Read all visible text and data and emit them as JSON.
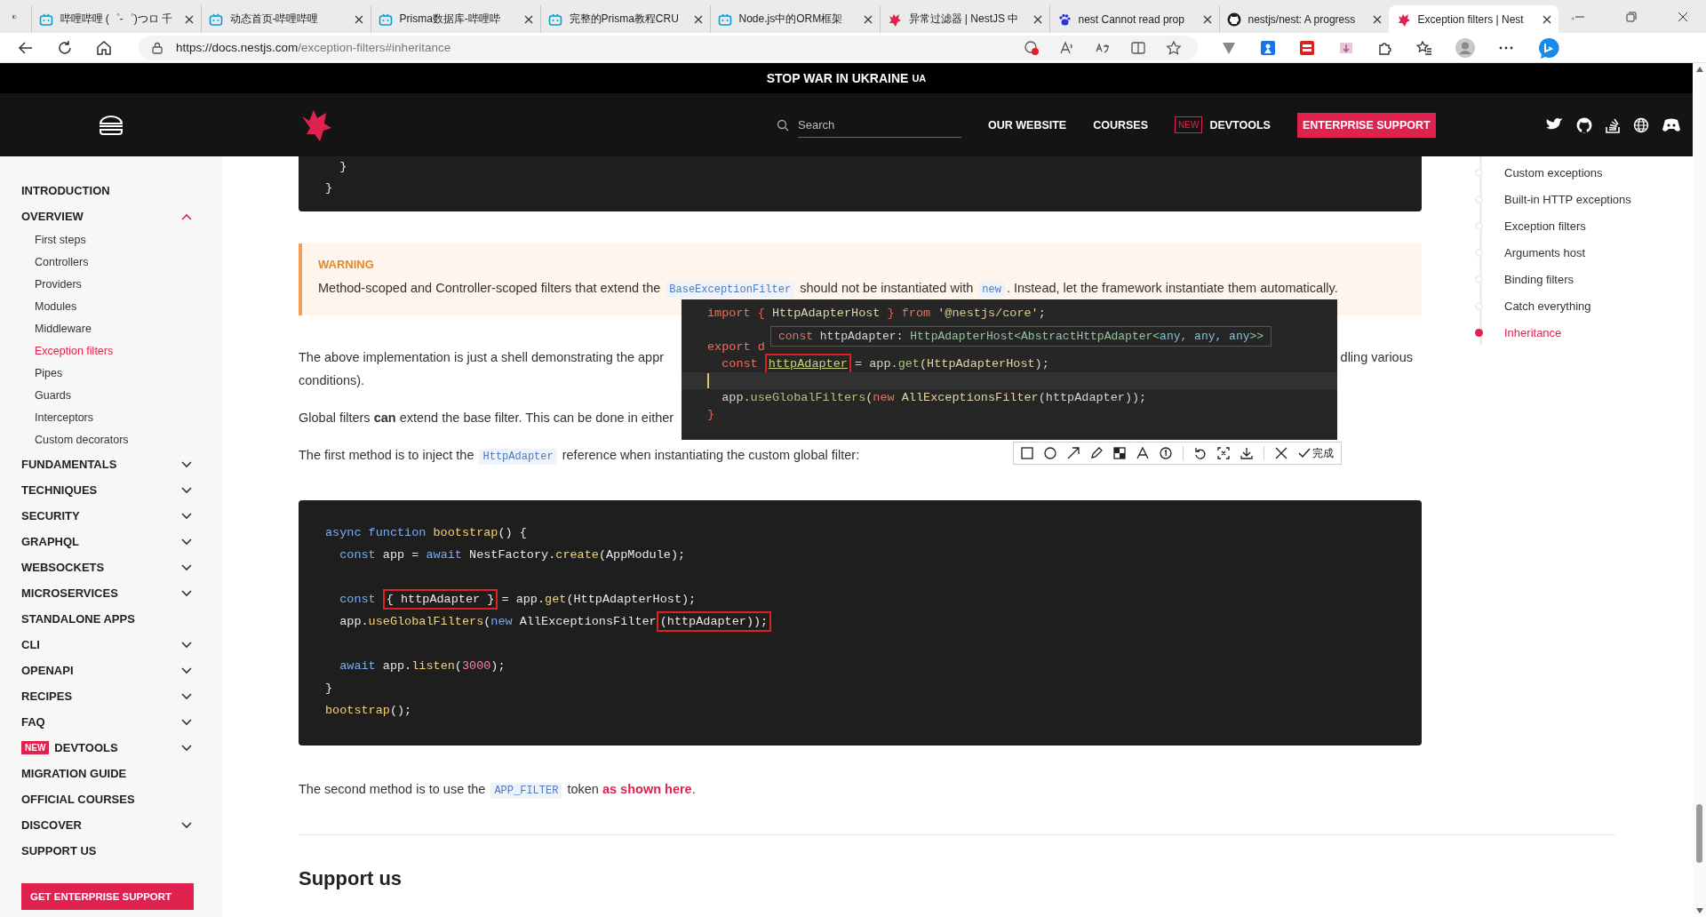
{
  "browser": {
    "tabs": [
      {
        "title": "哔哩哔哩 (゜-゜)つロ 千",
        "kind": "tv",
        "selected": false
      },
      {
        "title": "动态首页-哔哩哔哩",
        "kind": "tv",
        "selected": false
      },
      {
        "title": "Prisma数据库-哔哩哔",
        "kind": "tv",
        "selected": false
      },
      {
        "title": "完整的Prisma教程CRU",
        "kind": "tv",
        "selected": false
      },
      {
        "title": "Node.js中的ORM框架",
        "kind": "tv",
        "selected": false
      },
      {
        "title": "异常过滤器 | NestJS 中",
        "kind": "cat",
        "selected": false
      },
      {
        "title": "nest Cannot read prop",
        "kind": "paw",
        "selected": false
      },
      {
        "title": "nestjs/nest: A progress",
        "kind": "mark",
        "selected": false
      },
      {
        "title": "Exception filters | Nest",
        "kind": "cat",
        "selected": true
      }
    ],
    "url_host": "https://docs.nestjs.com",
    "url_path": "/exception-filters#inheritance"
  },
  "banner": {
    "text": "STOP WAR IN UKRAINE",
    "tag": "UA"
  },
  "nav": {
    "search": {
      "placeholder": "Search"
    },
    "links": [
      "OUR WEBSITE",
      "COURSES"
    ],
    "devtools": {
      "badge": "NEW",
      "label": "DEVTOOLS"
    },
    "cta": "ENTERPRISE SUPPORT"
  },
  "sidebar": {
    "items": [
      {
        "label": "INTRODUCTION",
        "kind": "link"
      },
      {
        "label": "OVERVIEW",
        "kind": "group",
        "expanded": true,
        "children": [
          {
            "label": "First steps",
            "selected": false
          },
          {
            "label": "Controllers",
            "selected": false
          },
          {
            "label": "Providers",
            "selected": false
          },
          {
            "label": "Modules",
            "selected": false
          },
          {
            "label": "Middleware",
            "selected": false
          },
          {
            "label": "Exception filters",
            "selected": true
          },
          {
            "label": "Pipes",
            "selected": false
          },
          {
            "label": "Guards",
            "selected": false
          },
          {
            "label": "Interceptors",
            "selected": false
          },
          {
            "label": "Custom decorators",
            "selected": false
          }
        ]
      },
      {
        "label": "FUNDAMENTALS",
        "kind": "group",
        "expanded": false
      },
      {
        "label": "TECHNIQUES",
        "kind": "group",
        "expanded": false
      },
      {
        "label": "SECURITY",
        "kind": "group",
        "expanded": false
      },
      {
        "label": "GRAPHQL",
        "kind": "group",
        "expanded": false
      },
      {
        "label": "WEBSOCKETS",
        "kind": "group",
        "expanded": false
      },
      {
        "label": "MICROSERVICES",
        "kind": "group",
        "expanded": false
      },
      {
        "label": "STANDALONE APPS",
        "kind": "link"
      },
      {
        "label": "CLI",
        "kind": "group",
        "expanded": false
      },
      {
        "label": "OPENAPI",
        "kind": "group",
        "expanded": false
      },
      {
        "label": "RECIPES",
        "kind": "group",
        "expanded": false
      },
      {
        "label": "FAQ",
        "kind": "group",
        "expanded": false
      },
      {
        "label": "DEVTOOLS",
        "kind": "group",
        "expanded": false,
        "badge": "NEW"
      },
      {
        "label": "MIGRATION GUIDE",
        "kind": "link"
      },
      {
        "label": "OFFICIAL COURSES",
        "kind": "link"
      },
      {
        "label": "DISCOVER",
        "kind": "group",
        "expanded": false
      },
      {
        "label": "SUPPORT US",
        "kind": "link"
      }
    ],
    "button": "GET ENTERPRISE SUPPORT"
  },
  "content": {
    "top_code": [
      "  }",
      "}"
    ],
    "warning": {
      "title": "WARNING",
      "parts": [
        {
          "t": "Method-scoped and Controller-scoped filters that extend the ",
          "kind": "text"
        },
        {
          "t": "BaseExceptionFilter",
          "kind": "code"
        },
        {
          "t": " should not be instantiated with ",
          "kind": "text"
        },
        {
          "t": "new",
          "kind": "code"
        },
        {
          "t": ". Instead, let the framework instantiate them automatically.",
          "kind": "text"
        }
      ]
    },
    "para_1": {
      "left": "The above implementation is just a shell demonstrating the appr",
      "right": "dling various",
      "line_2": "conditions)."
    },
    "para_2": "Global filters **can** extend the base filter. This can be done in either",
    "para_3": [
      {
        "t": "The first method is to inject the ",
        "kind": "text"
      },
      {
        "t": "HttpAdapter",
        "kind": "code"
      },
      {
        "t": " reference when instantiating the custom global filter:",
        "kind": "text"
      }
    ],
    "code": [
      {
        "kind": "code",
        "tokens": [
          {
            "t": "async function",
            "kind": "kw"
          },
          {
            "t": " bootstrap",
            "kind": "fn"
          },
          {
            "t": "() {",
            "kind": "p"
          }
        ]
      },
      {
        "kind": "code",
        "tokens": [
          {
            "t": "  const",
            "kind": "kw"
          },
          {
            "t": " app = ",
            "kind": "p"
          },
          {
            "t": "await",
            "kind": "kw"
          },
          {
            "t": " NestFactory.",
            "kind": "p"
          },
          {
            "t": "create",
            "kind": "fn"
          },
          {
            "t": "(AppModule);",
            "kind": "p"
          }
        ]
      },
      {
        "kind": "blank"
      },
      {
        "kind": "code",
        "tokens": [
          {
            "t": "  const ",
            "kind": "kw"
          },
          {
            "t": "{ httpAdapter }",
            "kind": "frame"
          },
          {
            "t": " = app.",
            "kind": "p"
          },
          {
            "t": "get",
            "kind": "fn"
          },
          {
            "t": "(HttpAdapterHost);",
            "kind": "p"
          }
        ]
      },
      {
        "kind": "code",
        "tokens": [
          {
            "t": "  app.",
            "kind": "p"
          },
          {
            "t": "useGlobalFilters",
            "kind": "fn"
          },
          {
            "t": "(",
            "kind": "p"
          },
          {
            "t": "new",
            "kind": "kw"
          },
          {
            "t": " AllExceptionsFilter",
            "kind": "p"
          },
          {
            "t": "(httpAdapter));",
            "kind": "frame"
          }
        ]
      },
      {
        "kind": "blank"
      },
      {
        "kind": "code",
        "tokens": [
          {
            "t": "  await",
            "kind": "kw"
          },
          {
            "t": " app.",
            "kind": "p"
          },
          {
            "t": "listen",
            "kind": "fn"
          },
          {
            "t": "(",
            "kind": "p"
          },
          {
            "t": "3000",
            "kind": "num"
          },
          {
            "t": ");",
            "kind": "p"
          }
        ]
      },
      {
        "kind": "code",
        "tokens": [
          {
            "t": "}",
            "kind": "p"
          }
        ]
      },
      {
        "kind": "code",
        "tokens": [
          {
            "t": "bootstrap",
            "kind": "fn"
          },
          {
            "t": "();",
            "kind": "p"
          }
        ]
      }
    ],
    "para_4": [
      {
        "t": "The second method is to use the ",
        "kind": "text"
      },
      {
        "t": "APP_FILTER",
        "kind": "code"
      },
      {
        "t": " token ",
        "kind": "text"
      },
      {
        "t": "as shown here",
        "kind": "link"
      },
      {
        "t": ".",
        "kind": "text"
      }
    ],
    "heading": "Support us"
  },
  "toc": [
    {
      "label": "Custom exceptions",
      "selected": false
    },
    {
      "label": "Built-in HTTP exceptions",
      "selected": false
    },
    {
      "label": "Exception filters",
      "selected": false
    },
    {
      "label": "Arguments host",
      "selected": false
    },
    {
      "label": "Binding filters",
      "selected": false
    },
    {
      "label": "Catch everything",
      "selected": false
    },
    {
      "label": "Inheritance",
      "selected": true
    }
  ],
  "capture": {
    "code": [
      {
        "kind": "code",
        "tokens": [
          {
            "t": "import",
            "kind": "kw"
          },
          {
            "t": " { ",
            "kind": "punct"
          },
          {
            "t": "HttpAdapterHost",
            "kind": "type"
          },
          {
            "t": " } ",
            "kind": "punct"
          },
          {
            "t": "from",
            "kind": "kw"
          },
          {
            "t": " '@nestjs/core'",
            "kind": "str"
          },
          {
            "t": ";",
            "kind": "p"
          }
        ]
      },
      {
        "kind": "blank"
      },
      {
        "kind": "code",
        "tokens": [
          {
            "t": "export d",
            "kind": "kw"
          }
        ]
      },
      {
        "kind": "code",
        "tokens": [
          {
            "t": "  const ",
            "kind": "kw"
          },
          {
            "t": "httpAdapter",
            "kind": "ref"
          },
          {
            "t": " = app.",
            "kind": "p"
          },
          {
            "t": "get",
            "kind": "fn"
          },
          {
            "t": "(",
            "kind": "p"
          },
          {
            "t": "HttpAdapterHost",
            "kind": "type"
          },
          {
            "t": ");",
            "kind": "p"
          }
        ]
      },
      {
        "kind": "cursor"
      },
      {
        "kind": "code",
        "tokens": [
          {
            "t": "  app.",
            "kind": "p"
          },
          {
            "t": "useGlobalFilters",
            "kind": "fn"
          },
          {
            "t": "(",
            "kind": "p"
          },
          {
            "t": "new",
            "kind": "kw"
          },
          {
            "t": " AllExceptionsFilter",
            "kind": "type"
          },
          {
            "t": "(httpAdapter));",
            "kind": "p"
          }
        ]
      },
      {
        "kind": "code",
        "tokens": [
          {
            "t": "}",
            "kind": "punct"
          }
        ]
      }
    ],
    "tooltip": [
      {
        "t": "const",
        "kind": "kw"
      },
      {
        "t": " httpAdapter: ",
        "kind": "p"
      },
      {
        "t": "HttpAdapterHost<AbstractHttpAdapter<",
        "kind": "gtype"
      },
      {
        "t": "any, any, any",
        "kind": "any"
      },
      {
        "t": ">>",
        "kind": "gtype"
      }
    ],
    "done": "完成"
  }
}
